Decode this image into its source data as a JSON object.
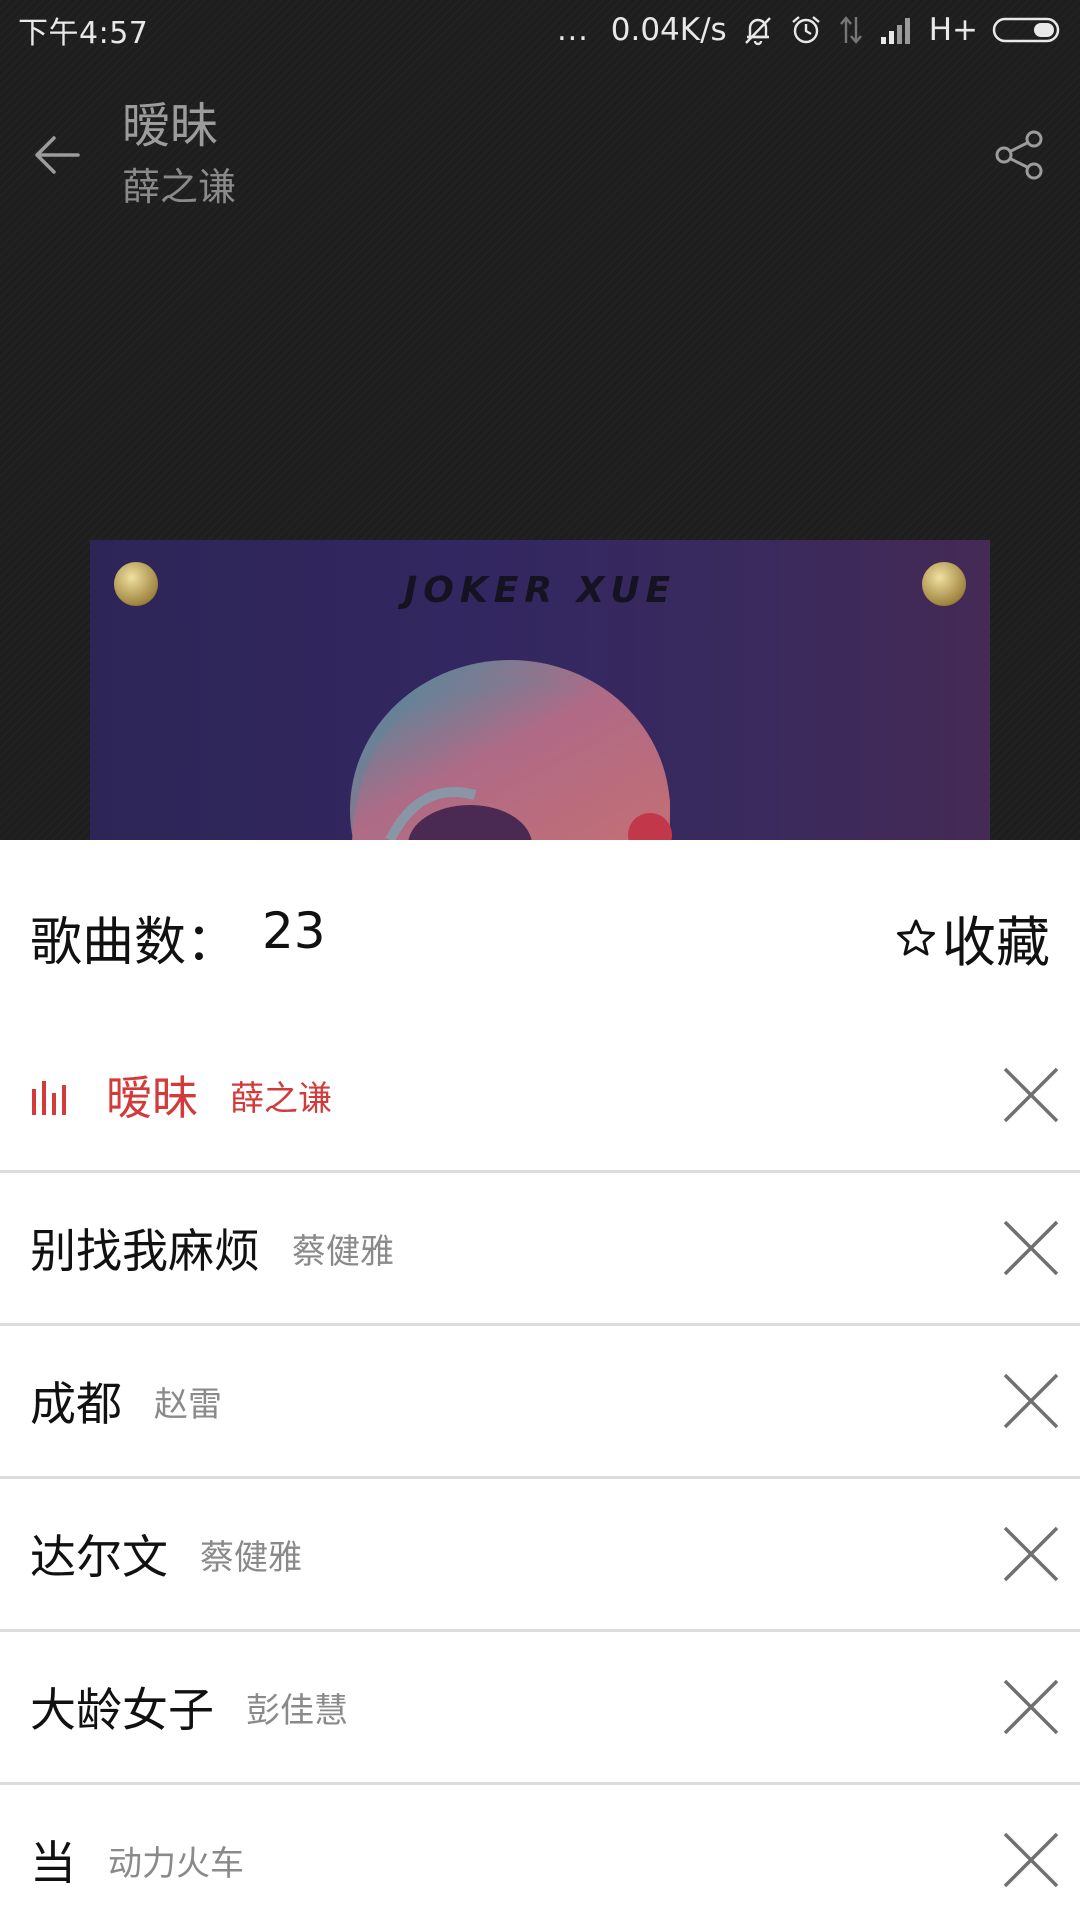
{
  "status_bar": {
    "time": "下午4:57",
    "dots": "...",
    "net_speed": "0.04K/s",
    "network_type": "H+",
    "icons": [
      "mute-icon",
      "alarm-icon",
      "data-arrows-icon",
      "signal-icon",
      "battery-icon"
    ]
  },
  "header": {
    "title": "暧昧",
    "artist": "薛之谦",
    "back_icon": "back-arrow-icon",
    "share_icon": "share-icon"
  },
  "album": {
    "brand_text": "JOKER XUE"
  },
  "playlist": {
    "count_label": "歌曲数：",
    "count_value": "23",
    "favorite_label": "收藏",
    "favorite_icon": "star-outline-icon",
    "accent_color": "#d33a3a",
    "songs": [
      {
        "title": "暧昧",
        "artist": "薛之谦",
        "playing": true
      },
      {
        "title": "别找我麻烦",
        "artist": "蔡健雅",
        "playing": false
      },
      {
        "title": "成都",
        "artist": "赵雷",
        "playing": false
      },
      {
        "title": "达尔文",
        "artist": "蔡健雅",
        "playing": false
      },
      {
        "title": "大龄女子",
        "artist": "彭佳慧",
        "playing": false
      },
      {
        "title": "当",
        "artist": "动力火车",
        "playing": false
      }
    ]
  }
}
